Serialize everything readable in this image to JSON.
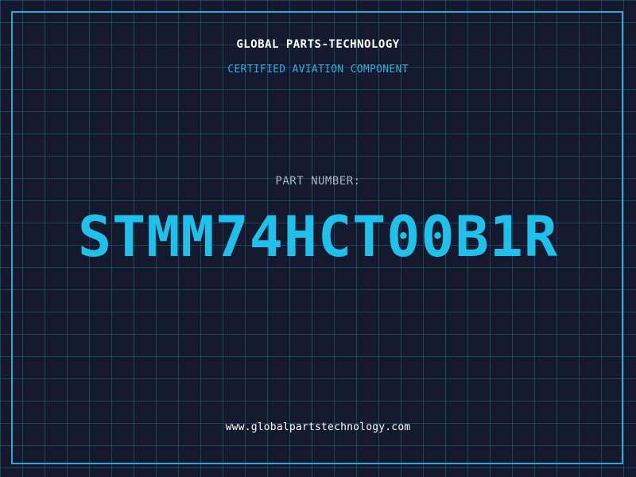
{
  "header": {
    "company": "GLOBAL PARTS-TECHNOLOGY",
    "subtitle": "CERTIFIED AVIATION COMPONENT"
  },
  "part": {
    "label": "PART NUMBER:",
    "number": "STMM74HCT00B1R"
  },
  "footer": {
    "website": "www.globalpartstechnology.com"
  },
  "colors": {
    "background": "#14192e",
    "grid": "#28788f",
    "accent": "#1ec0ec",
    "frame": "#29a9d4",
    "label": "#a7b2c2",
    "text": "#ffffff"
  }
}
